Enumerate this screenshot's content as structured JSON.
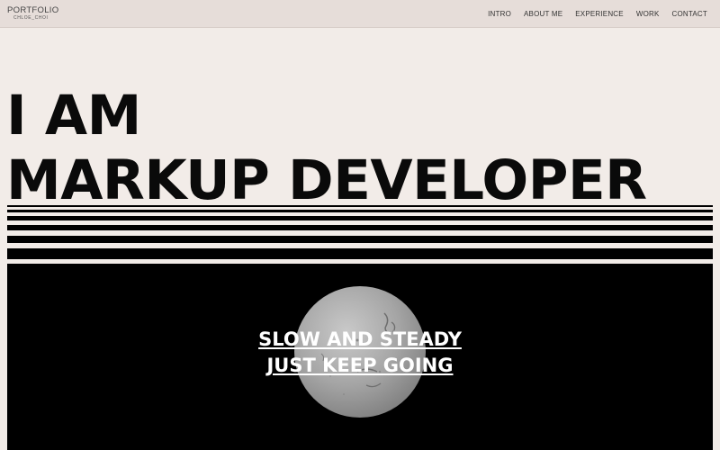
{
  "header": {
    "logo_title": "PORTFOLIO",
    "logo_subtitle": "CHLOE_CHOI",
    "nav": [
      "INTRO",
      "ABOUT ME",
      "EXPERIENCE",
      "WORK",
      "CONTACT"
    ]
  },
  "hero": {
    "line1": "I AM",
    "line2": "MARKUP DEVELOPER"
  },
  "banner": {
    "line1": "SLOW AND STEADY",
    "line2": "JUST KEEP GOING"
  },
  "colors": {
    "background": "#f2ece8",
    "header": "#e6ddd9",
    "text": "#0a0a0a",
    "panel": "#000000",
    "banner_text": "#ffffff"
  }
}
